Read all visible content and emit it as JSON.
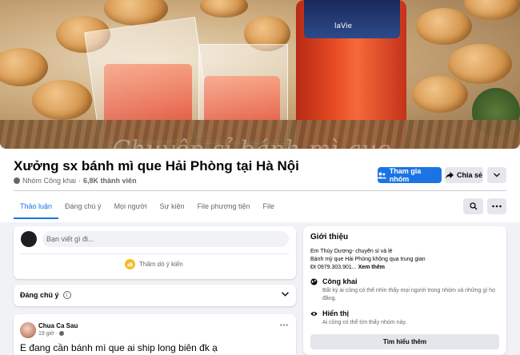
{
  "cover": {
    "bottle_brand": "laVie",
    "watermark": "Chuyên sỉ bánh mì que"
  },
  "group": {
    "title": "Xưởng sx bánh mì que Hải Phòng tại Hà Nội",
    "privacy": "Nhóm Công khai",
    "members": "6,8K thành viên"
  },
  "actions": {
    "join": "Tham gia nhóm",
    "share": "Chia sẻ"
  },
  "tabs": [
    {
      "label": "Thảo luận",
      "active": true
    },
    {
      "label": "Đáng chú ý",
      "active": false
    },
    {
      "label": "Mọi người",
      "active": false
    },
    {
      "label": "Sự kiện",
      "active": false
    },
    {
      "label": "File phương tiện",
      "active": false
    },
    {
      "label": "File",
      "active": false
    }
  ],
  "composer": {
    "placeholder": "Bạn viết gì đi...",
    "poll": "Thăm dò ý kiến"
  },
  "featured": {
    "label": "Đáng chú ý"
  },
  "post": {
    "author": "Chua Ca Sau",
    "time": "19 giờ",
    "text": "E đang cần bánh mì que ai ship long biên đk ạ"
  },
  "intro": {
    "title": "Giới thiệu",
    "line1": "Em Thùy Dương- chuyên sỉ và lẻ",
    "line2": "Bánh mỳ que Hải Phòng không qua trung gian",
    "phone": "Đt 0979.303.901...",
    "see_more": "Xem thêm",
    "public_title": "Công khai",
    "public_desc": "Bất kỳ ai cũng có thể nhìn thấy mọi người trong nhóm và những gì họ đăng.",
    "visible_title": "Hiển thị",
    "visible_desc": "Ai cũng có thể tìm thấy nhóm này.",
    "learn_more": "Tìm hiểu thêm"
  },
  "colors": {
    "primary": "#1b74e4",
    "background": "#f0f2f5",
    "secondary_button": "#e4e6eb",
    "muted_text": "#65676b"
  }
}
